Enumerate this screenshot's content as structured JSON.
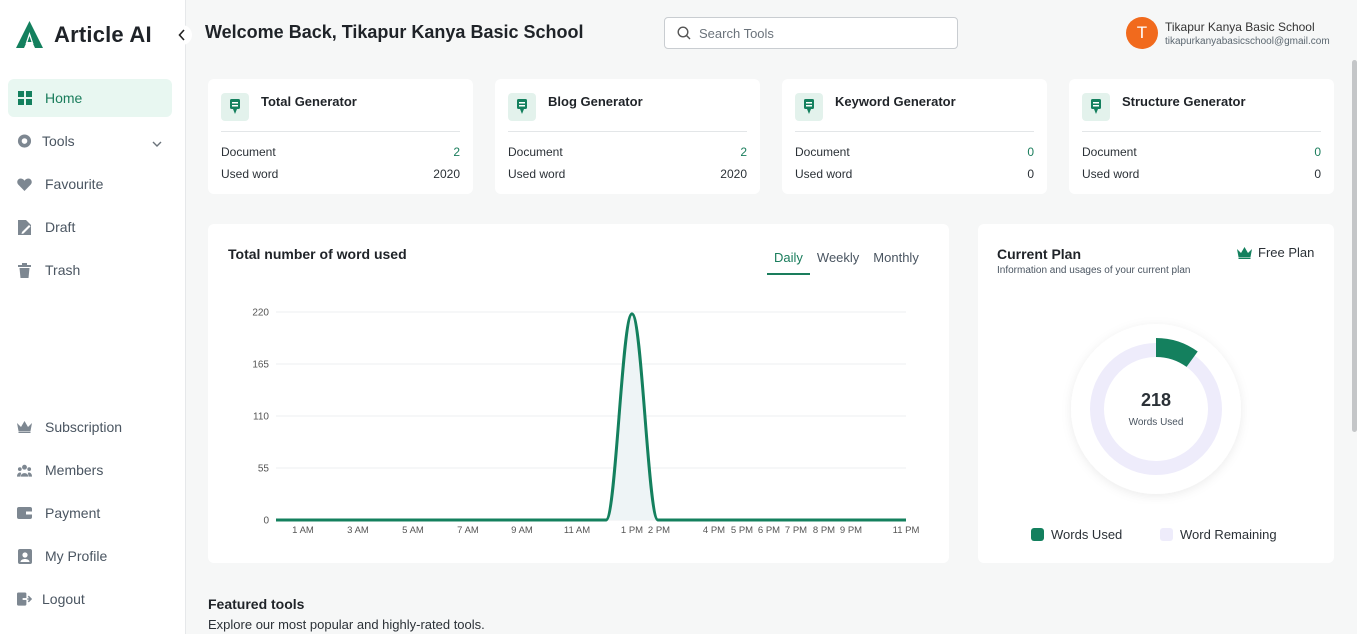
{
  "brand": {
    "name": "Article AI"
  },
  "sidebar": {
    "items": [
      {
        "label": "Home",
        "icon": "grid-icon",
        "active": true
      },
      {
        "label": "Tools",
        "icon": "tools-icon",
        "has_dropdown": true
      },
      {
        "label": "Favourite",
        "icon": "heart-icon"
      },
      {
        "label": "Draft",
        "icon": "draft-icon"
      },
      {
        "label": "Trash",
        "icon": "trash-icon"
      }
    ],
    "bottom_items": [
      {
        "label": "Subscription",
        "icon": "crown-icon"
      },
      {
        "label": "Members",
        "icon": "members-icon"
      },
      {
        "label": "Payment",
        "icon": "wallet-icon"
      },
      {
        "label": "My Profile",
        "icon": "profile-icon"
      },
      {
        "label": "Logout",
        "icon": "logout-icon"
      }
    ]
  },
  "header": {
    "welcome": "Welcome Back, Tikapur Kanya Basic School",
    "search_placeholder": "Search Tools",
    "user": {
      "initial": "T",
      "name": "Tikapur Kanya Basic School",
      "email": "tikapurkanyabasicschool@gmail.com"
    }
  },
  "stats": [
    {
      "title": "Total Generator",
      "doc_label": "Document",
      "doc_value": "2",
      "word_label": "Used word",
      "word_value": "2020"
    },
    {
      "title": "Blog Generator",
      "doc_label": "Document",
      "doc_value": "2",
      "word_label": "Used word",
      "word_value": "2020"
    },
    {
      "title": "Keyword Generator",
      "doc_label": "Document",
      "doc_value": "0",
      "word_label": "Used word",
      "word_value": "0"
    },
    {
      "title": "Structure Generator",
      "doc_label": "Document",
      "doc_value": "0",
      "word_label": "Used word",
      "word_value": "0"
    }
  ],
  "usage_chart": {
    "title": "Total number of word used",
    "tabs": [
      "Daily",
      "Weekly",
      "Monthly"
    ],
    "active_tab": "Daily"
  },
  "chart_data": {
    "type": "area",
    "title": "Total number of word used",
    "x": [
      "1 AM",
      "3 AM",
      "5 AM",
      "7 AM",
      "9 AM",
      "11 AM",
      "1 PM",
      "2 PM",
      "4 PM",
      "5 PM",
      "6 PM",
      "7 PM",
      "8 PM",
      "9 PM",
      "11 PM"
    ],
    "series": [
      {
        "values": [
          0,
          0,
          0,
          0,
          0,
          0,
          218,
          0,
          0,
          0,
          0,
          0,
          0,
          0,
          0
        ]
      }
    ],
    "yticks": [
      0,
      55,
      110,
      165,
      220
    ],
    "ylim": [
      0,
      220
    ],
    "grid": true,
    "color": "#14805e"
  },
  "plan": {
    "title": "Current Plan",
    "subtitle": "Information and usages of your current plan",
    "badge": "Free Plan",
    "words_used_value": "218",
    "words_used_label": "Words Used",
    "used_fraction": 0.1,
    "legend": [
      {
        "label": "Words Used",
        "color": "#14805e"
      },
      {
        "label": "Word Remaining",
        "color": "#eeecfb"
      }
    ]
  },
  "featured": {
    "title": "Featured tools",
    "subtitle": "Explore our most popular and highly-rated tools."
  }
}
